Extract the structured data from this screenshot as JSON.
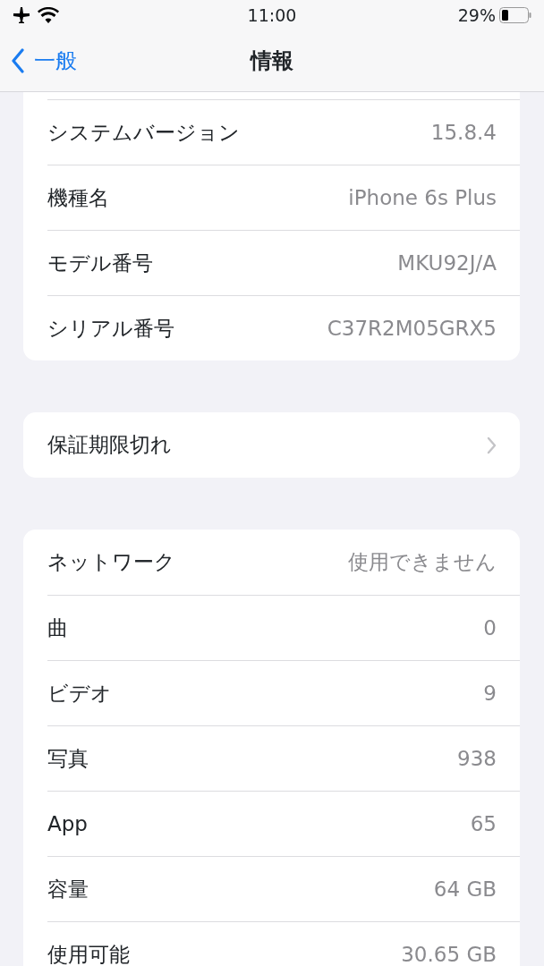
{
  "status_bar": {
    "time": "11:00",
    "battery": "29%"
  },
  "nav": {
    "back": "一般",
    "title": "情報"
  },
  "sections": [
    {
      "rows": [
        {
          "kind": "info",
          "label": "システムバージョン",
          "value": "15.8.4"
        },
        {
          "kind": "info",
          "label": "機種名",
          "value": "iPhone 6s Plus"
        },
        {
          "kind": "info",
          "label": "モデル番号",
          "value": "MKU92J/A"
        },
        {
          "kind": "info",
          "label": "シリアル番号",
          "value": "C37R2M05GRX5"
        }
      ]
    },
    {
      "rows": [
        {
          "kind": "link",
          "label": "保証期限切れ"
        }
      ]
    },
    {
      "rows": [
        {
          "kind": "info",
          "label": "ネットワーク",
          "value": "使用できません"
        },
        {
          "kind": "info",
          "label": "曲",
          "value": "0"
        },
        {
          "kind": "info",
          "label": "ビデオ",
          "value": "9"
        },
        {
          "kind": "info",
          "label": "写真",
          "value": "938"
        },
        {
          "kind": "info",
          "label": "App",
          "value": "65"
        },
        {
          "kind": "info",
          "label": "容量",
          "value": "64 GB"
        },
        {
          "kind": "info",
          "label": "使用可能",
          "value": "30.65 GB"
        }
      ]
    }
  ]
}
